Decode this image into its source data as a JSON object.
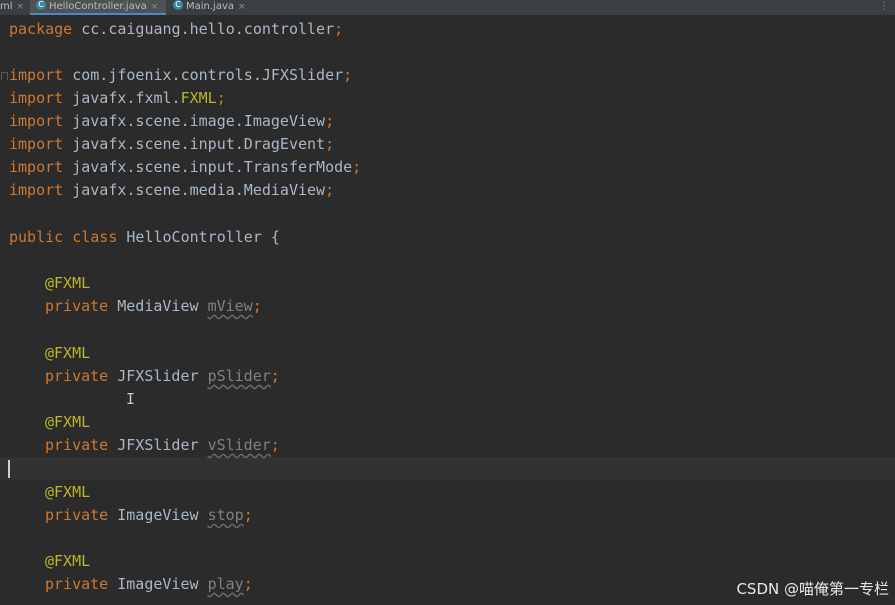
{
  "tabs": [
    {
      "label": "ml",
      "active": false
    },
    {
      "label": "HelloController.java",
      "active": true
    },
    {
      "label": "Main.java",
      "active": false
    }
  ],
  "tab_close": "×",
  "tab_more": "⋮",
  "code": {
    "package_kw": "package",
    "package_name": " cc.caiguang.hello.controller",
    "semi": ";",
    "import_kw": "import",
    "imports": [
      " com.jfoenix.controls.JFXSlider",
      " javafx.fxml.",
      " javafx.scene.image.ImageView",
      " javafx.scene.input.DragEvent",
      " javafx.scene.input.TransferMode",
      " javafx.scene.media.MediaView"
    ],
    "fxml_import_tail": "FXML",
    "public_kw": "public",
    "class_kw": " class",
    "class_name": " HelloController {",
    "annotation": "@FXML",
    "private_kw": "private",
    "fields": [
      {
        "type": " MediaView ",
        "name": "mView"
      },
      {
        "type": " JFXSlider ",
        "name": "pSlider"
      },
      {
        "type": " JFXSlider ",
        "name": "vSlider"
      },
      {
        "type": " ImageView ",
        "name": "stop"
      },
      {
        "type": " ImageView ",
        "name": "play"
      }
    ]
  },
  "watermark": "CSDN @喵俺第一专栏",
  "colors": {
    "background": "#2b2b2b",
    "keyword": "#cc7832",
    "annotation": "#bbb529",
    "text": "#a9b7c6",
    "unused_field": "#808080"
  }
}
